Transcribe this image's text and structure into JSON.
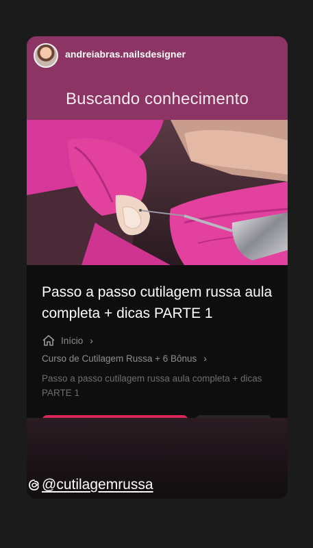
{
  "story": {
    "username": "andreiabras.nailsdesigner",
    "headline": "Buscando conhecimento",
    "mention": "@cutilagemrussa"
  },
  "post": {
    "title": "Passo a passo cutilagem russa aula completa + dicas PARTE 1",
    "breadcrumb": {
      "home_label": "Início",
      "course_label": "Curso de Cutilagem Russa + 6 Bônus"
    },
    "subtitle": "Passo a passo cutilagem russa aula completa + dicas PARTE 1"
  },
  "icons": {
    "home": "home-icon",
    "chevron": "chevron-right-icon",
    "mention": "threads-icon"
  },
  "colors": {
    "header_bg": "#8c3565",
    "card_bg": "#0d0d0d",
    "accent": "#d9265a",
    "glove": "#e2419e"
  }
}
